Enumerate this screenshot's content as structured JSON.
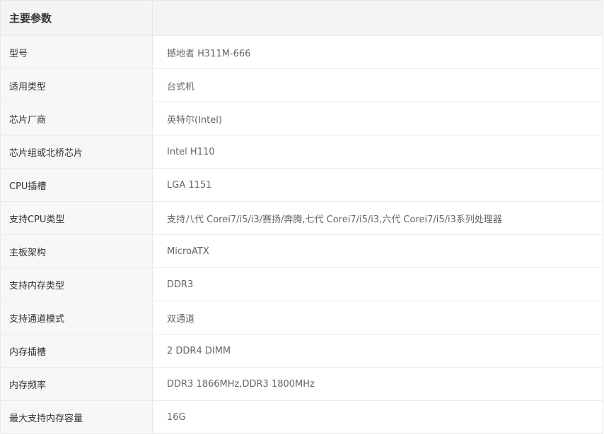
{
  "header": {
    "title": "主要参数"
  },
  "specs": [
    {
      "label": "型号",
      "value": "撼地者 H311M-666"
    },
    {
      "label": "适用类型",
      "value": "台式机"
    },
    {
      "label": "芯片厂商",
      "value": "英特尔(Intel)"
    },
    {
      "label": "芯片组或北桥芯片",
      "value": "Intel H110"
    },
    {
      "label": "CPU插槽",
      "value": "LGA 1151"
    },
    {
      "label": "支持CPU类型",
      "value": "支持八代 Corei7/i5/i3/赛扬/奔腾,七代 Corei7/i5/i3,六代 Corei7/i5/i3系列处理器"
    },
    {
      "label": "主板架构",
      "value": "MicroATX"
    },
    {
      "label": "支持内存类型",
      "value": "DDR3"
    },
    {
      "label": "支持通道模式",
      "value": "双通道"
    },
    {
      "label": "内存插槽",
      "value": "2 DDR4 DIMM"
    },
    {
      "label": "内存频率",
      "value": "DDR3 1866MHz,DDR3 1800MHz"
    },
    {
      "label": "最大支持内存容量",
      "value": "16G"
    }
  ]
}
